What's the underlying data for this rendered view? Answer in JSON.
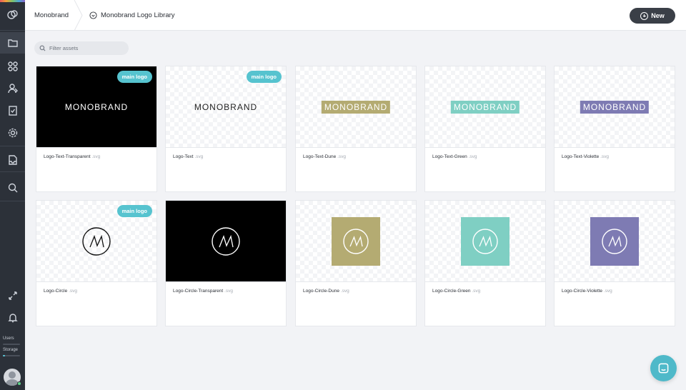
{
  "breadcrumb": {
    "root": "Monobrand",
    "library": "Monobrand Logo Library"
  },
  "new_button": {
    "label": "New"
  },
  "filter": {
    "placeholder": "Filter assets"
  },
  "sidebar": {
    "items": [
      "logo-icon",
      "folder-icon",
      "apps-icon",
      "users-icon",
      "tasks-icon",
      "settings-icon",
      "inbox-icon",
      "search-icon",
      "expand-icon",
      "bell-icon"
    ],
    "users_label": "Users",
    "storage_label": "Storage",
    "storage_fraction": 0.12
  },
  "brand": {
    "wordmark": "MONOBRAND",
    "dune": "#b4ab72",
    "green": "#7fcfc3",
    "violette": "#7e7bb3",
    "accent": "#56c3cf"
  },
  "assets": [
    {
      "name": "Logo-Text-Transparent",
      "ext": ".svg",
      "badge": "main logo"
    },
    {
      "name": "Logo-Text",
      "ext": ".svg",
      "badge": "main logo"
    },
    {
      "name": "Logo-Text-Dune",
      "ext": ".svg",
      "badge": ""
    },
    {
      "name": "Logo-Text-Green",
      "ext": ".svg",
      "badge": ""
    },
    {
      "name": "Logo-Text-Violette",
      "ext": ".svg",
      "badge": ""
    },
    {
      "name": "Logo-Circle",
      "ext": ".svg",
      "badge": "main logo"
    },
    {
      "name": "Logo-Circle-Transparent",
      "ext": ".svg",
      "badge": ""
    },
    {
      "name": "Logo-Circle-Dune",
      "ext": ".svg",
      "badge": ""
    },
    {
      "name": "Logo-Circle-Green",
      "ext": ".svg",
      "badge": ""
    },
    {
      "name": "Logo-Circle-Violette",
      "ext": ".svg",
      "badge": ""
    }
  ]
}
